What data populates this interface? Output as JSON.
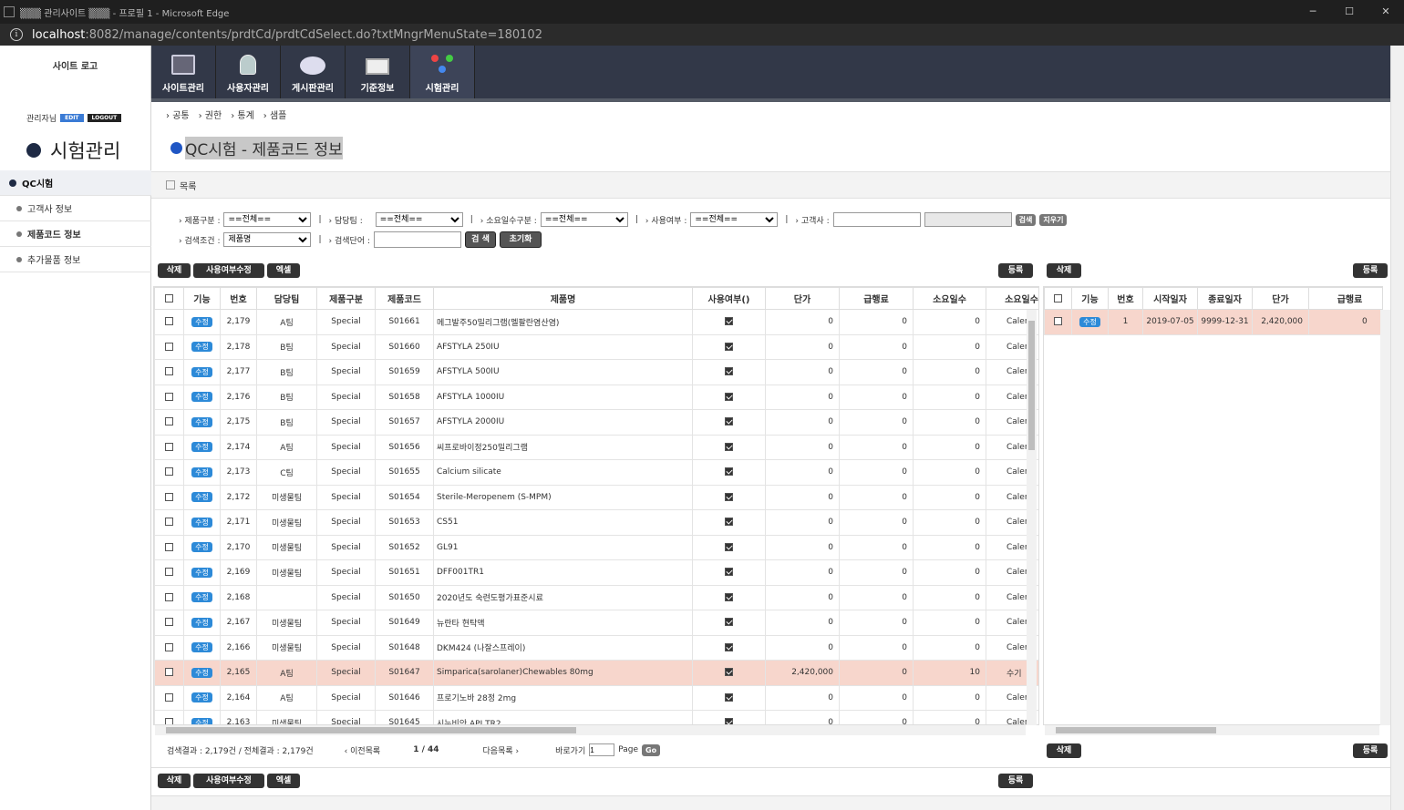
{
  "window": {
    "title": "▒▒▒ 관리사이트 ▒▒▒ - 프로필 1 - Microsoft Edge",
    "min": "─",
    "max": "☐",
    "close": "✕"
  },
  "address": {
    "host": "localhost",
    "path": ":8082/manage/contents/prdtCd/prdtCdSelect.do?txtMngrMenuState=180102"
  },
  "logo": "사이트 로고",
  "topnav": [
    {
      "label": "사이트관리",
      "icon": "monitor-icon"
    },
    {
      "label": "사용자관리",
      "icon": "user-icon"
    },
    {
      "label": "게시판관리",
      "icon": "chat-icon"
    },
    {
      "label": "기준정보",
      "icon": "box-icon"
    },
    {
      "label": "시험관리",
      "icon": "molecule-icon"
    }
  ],
  "admin": {
    "label": "관리자님",
    "edit": "EDIT",
    "logout": "LOGOUT"
  },
  "section_title": "시험관리",
  "sidemenu": {
    "main": "QC시험",
    "items": [
      "고객사 정보",
      "제품코드 정보",
      "추가물품 정보"
    ]
  },
  "breadcrumb": [
    "공통",
    "권한",
    "통계",
    "샘플"
  ],
  "page_title": "QC시험 - 제품코드 정보",
  "list_label": "목록",
  "filters": {
    "prod_type": {
      "label": "제품구분 :",
      "value": "==전체=="
    },
    "team": {
      "label": "담당팀 :",
      "value": "==전체=="
    },
    "days_type": {
      "label": "소요일수구분 :",
      "value": "==전체=="
    },
    "use": {
      "label": "사용여부 :",
      "value": "==전체=="
    },
    "customer": {
      "label": "고객사 :",
      "value": "",
      "search": "검색",
      "clear": "지우기"
    },
    "cond": {
      "label": "검색조건 :",
      "value": "제품명"
    },
    "keyword": {
      "label": "검색단어 :",
      "value": ""
    },
    "search_btn": "검 색",
    "reset_btn": "초기화"
  },
  "actions": {
    "delete": "삭제",
    "use_edit": "사용여부수정",
    "excel": "엑셀",
    "register": "등록"
  },
  "table": {
    "headers": [
      "",
      "기능",
      "번호",
      "담당팀",
      "제품구분",
      "제품코드",
      "제품명",
      "사용여부()",
      "단가",
      "급행료",
      "소요일수",
      "소요일수"
    ],
    "edit_label": "수정",
    "rows": [
      {
        "no": "2,179",
        "team": "A팀",
        "type": "Special",
        "code": "S01661",
        "name": "메그발주50밀리그램(멜팔란염산염)",
        "price": "0",
        "exp": "0",
        "days": "0",
        "dtype": "Caler"
      },
      {
        "no": "2,178",
        "team": "B팀",
        "type": "Special",
        "code": "S01660",
        "name": "AFSTYLA 250IU",
        "price": "0",
        "exp": "0",
        "days": "0",
        "dtype": "Caler"
      },
      {
        "no": "2,177",
        "team": "B팀",
        "type": "Special",
        "code": "S01659",
        "name": "AFSTYLA 500IU",
        "price": "0",
        "exp": "0",
        "days": "0",
        "dtype": "Caler"
      },
      {
        "no": "2,176",
        "team": "B팀",
        "type": "Special",
        "code": "S01658",
        "name": "AFSTYLA 1000IU",
        "price": "0",
        "exp": "0",
        "days": "0",
        "dtype": "Caler"
      },
      {
        "no": "2,175",
        "team": "B팀",
        "type": "Special",
        "code": "S01657",
        "name": "AFSTYLA 2000IU",
        "price": "0",
        "exp": "0",
        "days": "0",
        "dtype": "Caler"
      },
      {
        "no": "2,174",
        "team": "A팀",
        "type": "Special",
        "code": "S01656",
        "name": "씨프로바이정250밀리그램",
        "price": "0",
        "exp": "0",
        "days": "0",
        "dtype": "Caler"
      },
      {
        "no": "2,173",
        "team": "C팀",
        "type": "Special",
        "code": "S01655",
        "name": "Calcium silicate",
        "price": "0",
        "exp": "0",
        "days": "0",
        "dtype": "Caler"
      },
      {
        "no": "2,172",
        "team": "미생물팀",
        "type": "Special",
        "code": "S01654",
        "name": "Sterile-Meropenem (S-MPM)",
        "price": "0",
        "exp": "0",
        "days": "0",
        "dtype": "Caler"
      },
      {
        "no": "2,171",
        "team": "미생물팀",
        "type": "Special",
        "code": "S01653",
        "name": "CS51",
        "price": "0",
        "exp": "0",
        "days": "0",
        "dtype": "Caler"
      },
      {
        "no": "2,170",
        "team": "미생물팀",
        "type": "Special",
        "code": "S01652",
        "name": "GL91",
        "price": "0",
        "exp": "0",
        "days": "0",
        "dtype": "Caler"
      },
      {
        "no": "2,169",
        "team": "미생물팀",
        "type": "Special",
        "code": "S01651",
        "name": "DFF001TR1",
        "price": "0",
        "exp": "0",
        "days": "0",
        "dtype": "Caler"
      },
      {
        "no": "2,168",
        "team": "",
        "type": "Special",
        "code": "S01650",
        "name": "2020년도 숙련도평가표준시료",
        "price": "0",
        "exp": "0",
        "days": "0",
        "dtype": "Caler"
      },
      {
        "no": "2,167",
        "team": "미생물팀",
        "type": "Special",
        "code": "S01649",
        "name": "뉴란타 현탁액",
        "price": "0",
        "exp": "0",
        "days": "0",
        "dtype": "Caler"
      },
      {
        "no": "2,166",
        "team": "미생물팀",
        "type": "Special",
        "code": "S01648",
        "name": "DKM424 (나잘스프레이)",
        "price": "0",
        "exp": "0",
        "days": "0",
        "dtype": "Caler"
      },
      {
        "no": "2,165",
        "team": "A팀",
        "type": "Special",
        "code": "S01647",
        "name": "Simparica(sarolaner)Chewables 80mg",
        "price": "2,420,000",
        "exp": "0",
        "days": "10",
        "dtype": "수기"
      },
      {
        "no": "2,164",
        "team": "A팀",
        "type": "Special",
        "code": "S01646",
        "name": "프로기노바 28정 2mg",
        "price": "0",
        "exp": "0",
        "days": "0",
        "dtype": "Caler"
      },
      {
        "no": "2,163",
        "team": "미생물팀",
        "type": "Special",
        "code": "S01645",
        "name": "시누비안 API TR2",
        "price": "0",
        "exp": "0",
        "days": "0",
        "dtype": "Caler"
      }
    ]
  },
  "pager": {
    "result": "검색결과 : 2,179건 / 전체결과 : 2,179건",
    "prev": "이전목록",
    "page": "1 / 44",
    "next": "다음목록",
    "goto": "바로가기",
    "goto_value": "1",
    "page_label": "Page",
    "go": "Go"
  },
  "right_table": {
    "headers": [
      "",
      "기능",
      "번호",
      "시작일자",
      "종료일자",
      "단가",
      "급행료"
    ],
    "rows": [
      {
        "no": "1",
        "start": "2019-07-05",
        "end": "9999-12-31",
        "price": "2,420,000",
        "exp": "0"
      }
    ]
  }
}
